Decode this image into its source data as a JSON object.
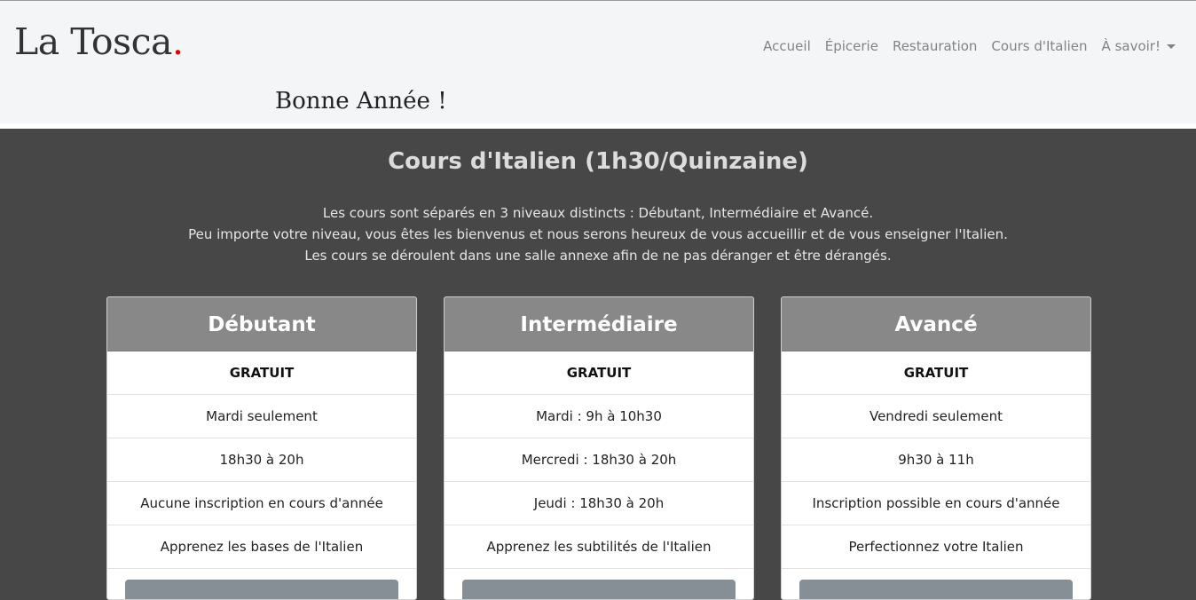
{
  "brand": {
    "name": "La Tosca",
    "dot": "."
  },
  "nav": {
    "items": [
      "Accueil",
      "Épicerie",
      "Restauration",
      "Cours d'Italien"
    ],
    "dropdown_label": "À savoir!"
  },
  "announcement": "Bonne Année !",
  "section": {
    "title": "Cours d'Italien (1h30/Quinzaine)",
    "intro": [
      "Les cours sont séparés en 3 niveaux distincts : Débutant, Intermédiaire et Avancé.",
      "Peu importe votre niveau, vous êtes les bienvenus et nous serons heureux de vous accueillir et de vous enseigner l'Italien.",
      "Les cours se déroulent dans une salle annexe afin de ne pas déranger et être dérangés."
    ]
  },
  "cards": [
    {
      "title": "Débutant",
      "price": "GRATUIT",
      "lines": [
        "Mardi seulement",
        "18h30 à 20h",
        "Aucune inscription en cours d'année",
        "Apprenez les bases de l'Italien"
      ]
    },
    {
      "title": "Intermédiaire",
      "price": "GRATUIT",
      "lines": [
        "Mardi : 9h à 10h30",
        "Mercredi : 18h30 à 20h",
        "Jeudi : 18h30 à 20h",
        "Apprenez les subtilités de l'Italien"
      ]
    },
    {
      "title": "Avancé",
      "price": "GRATUIT",
      "lines": [
        "Vendredi seulement",
        "9h30 à 11h",
        "Inscription possible en cours d'année",
        "Perfectionnez votre Italien"
      ]
    }
  ],
  "colors": {
    "navbar_bg": "#f4f5f7",
    "brand_dot": "#e10000",
    "section_bg": "#474747",
    "card_header_bg": "#888888",
    "button_bg": "#868e96"
  }
}
